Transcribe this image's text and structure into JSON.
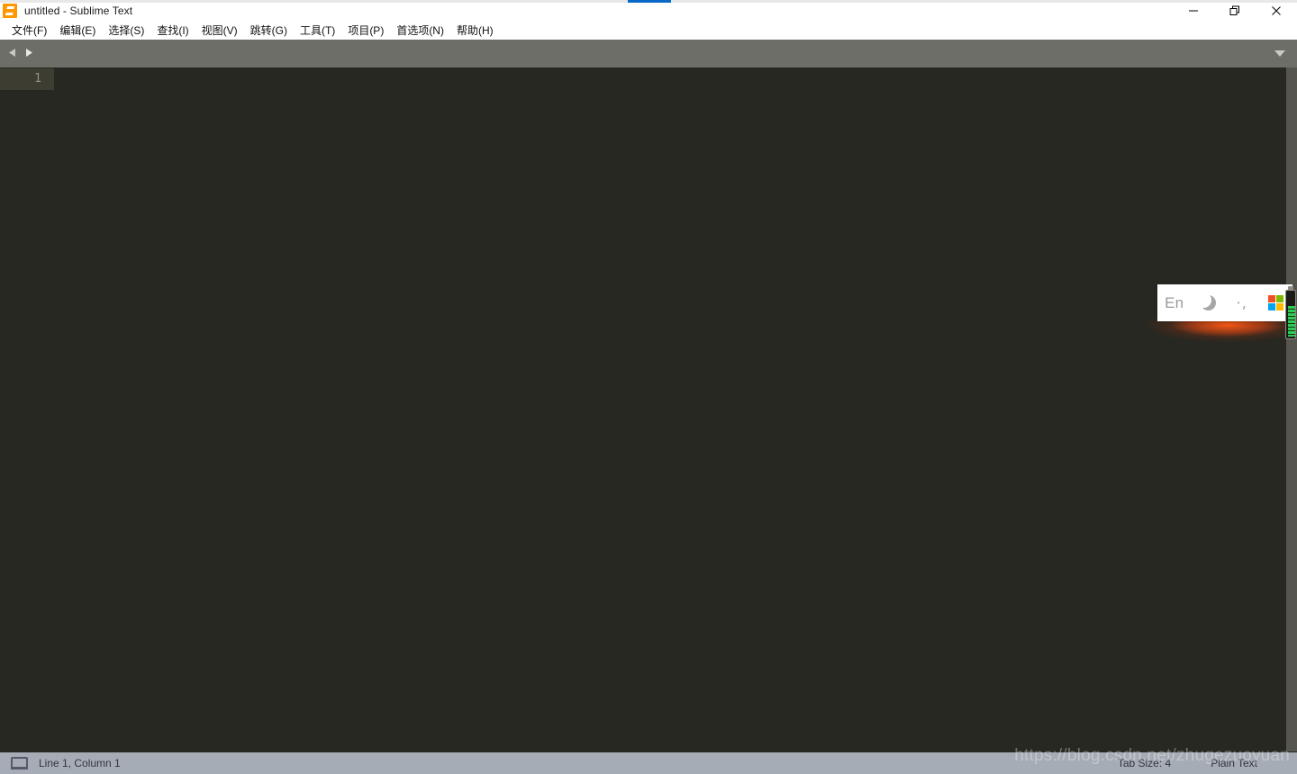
{
  "window": {
    "title": "untitled - Sublime Text",
    "app_icon": "sublime-text-icon",
    "controls": {
      "minimize": "minimize-icon",
      "restore": "restore-icon",
      "close": "close-icon"
    },
    "accent_blue": "#0a68c7"
  },
  "menubar": {
    "items": [
      {
        "label": "文件(F)"
      },
      {
        "label": "编辑(E)"
      },
      {
        "label": "选择(S)"
      },
      {
        "label": "查找(I)"
      },
      {
        "label": "视图(V)"
      },
      {
        "label": "跳转(G)"
      },
      {
        "label": "工具(T)"
      },
      {
        "label": "项目(P)"
      },
      {
        "label": "首选项(N)"
      },
      {
        "label": "帮助(H)"
      }
    ]
  },
  "tabbar": {
    "prev_icon": "arrow-left-icon",
    "next_icon": "arrow-right-icon",
    "menu_icon": "chevron-down-icon",
    "background": "#6e6e68"
  },
  "editor": {
    "background": "#272822",
    "active_line_background": "#3e3d32",
    "line_numbers": [
      "1"
    ],
    "content": ""
  },
  "battery": {
    "name": "battery-indicator",
    "level_color": "#2ecc55"
  },
  "ime_popup": {
    "language": "En",
    "moon_icon": "moon-icon",
    "punctuation_icon": "punctuation-icon",
    "windows_icon": "microsoft-logo-icon",
    "ms_colors": {
      "top_left": "#f25022",
      "top_right": "#7fba00",
      "bottom_left": "#00a4ef",
      "bottom_right": "#ffb900"
    }
  },
  "statusbar": {
    "left_icon": "laptop-icon",
    "cursor_position": "Line 1, Column 1",
    "tab_size": "Tab Size: 4",
    "syntax": "Plain Text",
    "background": "#a5acb5"
  },
  "watermark": {
    "text": "https://blog.csdn.net/zhugezuoyuan"
  }
}
